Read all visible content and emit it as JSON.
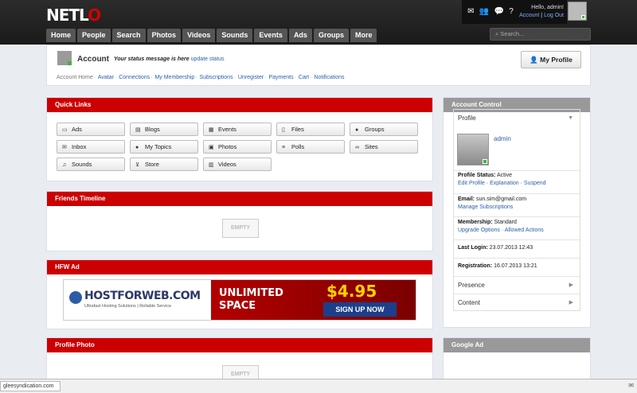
{
  "header": {
    "logo": "NETLO",
    "greeting": "Hello, admin!",
    "account_link": "Account",
    "logout_link": "Log Out",
    "search_placeholder": "Search..."
  },
  "nav": [
    "Home",
    "People",
    "Search",
    "Photos",
    "Videos",
    "Sounds",
    "Events",
    "Ads",
    "Groups",
    "More"
  ],
  "account": {
    "title": "Account",
    "status_message": "Your status message is here",
    "update_status": "update status",
    "my_profile_button": "My Profile",
    "links": [
      "Account Home",
      "Avatar",
      "Connections",
      "My Membership",
      "Subscriptions",
      "Unregister",
      "Payments",
      "Cart",
      "Notifications"
    ]
  },
  "quick_links": {
    "title": "Quick Links",
    "items": [
      {
        "label": "Ads",
        "icon": "monitor-icon"
      },
      {
        "label": "Blogs",
        "icon": "book-icon"
      },
      {
        "label": "Events",
        "icon": "calendar-icon"
      },
      {
        "label": "Files",
        "icon": "file-icon"
      },
      {
        "label": "Groups",
        "icon": "groups-icon"
      },
      {
        "label": "Inbox",
        "icon": "envelope-icon"
      },
      {
        "label": "My Topics",
        "icon": "comments-icon"
      },
      {
        "label": "Photos",
        "icon": "picture-icon"
      },
      {
        "label": "Polls",
        "icon": "list-icon"
      },
      {
        "label": "Sites",
        "icon": "link-icon"
      },
      {
        "label": "Sounds",
        "icon": "music-icon"
      },
      {
        "label": "Store",
        "icon": "cart-icon"
      },
      {
        "label": "Videos",
        "icon": "film-icon"
      }
    ]
  },
  "friends_timeline": {
    "title": "Friends Timeline",
    "empty": "EMPTY"
  },
  "hfw_ad": {
    "title": "HFW Ad",
    "brand": "HOSTFORWEB.COM",
    "tagline": "Ultrafast Hosting Solutions | Reliable Service",
    "headline_1": "UNLIMITED",
    "headline_2": "SPACE",
    "price": "$4.95",
    "cta": "SIGN UP NOW"
  },
  "profile_photo": {
    "title": "Profile Photo",
    "empty": "EMPTY"
  },
  "account_control": {
    "title": "Account Control",
    "profile_label": "Profile",
    "username": "admin",
    "profile_status_label": "Profile Status:",
    "profile_status_value": "Active",
    "status_links": [
      "Edit Profile",
      "Explanation",
      "Suspend"
    ],
    "email_label": "Email:",
    "email_value": "sun.sim@gmail.com",
    "manage_subscriptions": "Manage Subscriptions",
    "membership_label": "Membership:",
    "membership_value": "Standard",
    "membership_links": [
      "Upgrade Options",
      "Allowed Actions"
    ],
    "last_login_label": "Last Login:",
    "last_login_value": "23.07.2013 12:43",
    "registration_label": "Registration:",
    "registration_value": "16.07.2013 13:21",
    "presence_label": "Presence",
    "content_label": "Content"
  },
  "google_ad": {
    "title": "Google Ad"
  },
  "statusbar": {
    "url": "gleesyndication.com"
  },
  "colors": {
    "accent_red": "#cc0000",
    "panel_gray": "#999999",
    "link_blue": "#2a5fa8",
    "online_green": "#3cb43c"
  }
}
